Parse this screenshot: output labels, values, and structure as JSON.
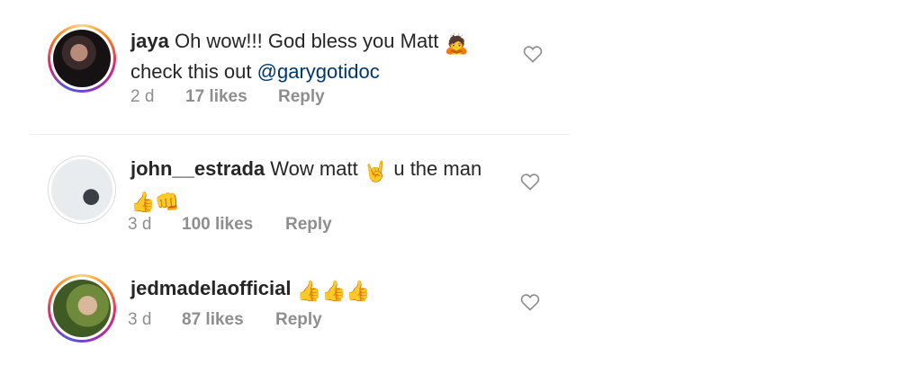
{
  "comments": [
    {
      "username": "jaya",
      "text_line1": "Oh wow!!! God bless you Matt",
      "text_line1_emoji": "🙇",
      "text_line2_prefix": "check this out",
      "mention": "@garygotidoc",
      "age": "2 d",
      "likes": "17 likes",
      "reply": "Reply"
    },
    {
      "username": "john__estrada",
      "text_line1": "Wow matt",
      "text_line1_emoji": "🤘",
      "text_line1_suffix": "u the man",
      "line2_emoji": "👍👊",
      "age": "3 d",
      "likes": "100 likes",
      "reply": "Reply"
    },
    {
      "username": "jedmadelaofficial",
      "text_line1": "👍👍👍",
      "age": "3 d",
      "likes": "87 likes",
      "reply": "Reply"
    }
  ],
  "icons": {
    "like": "heart-outline-icon"
  },
  "colors": {
    "text": "#262626",
    "meta": "#8e8e8e",
    "mention": "#00376b"
  }
}
